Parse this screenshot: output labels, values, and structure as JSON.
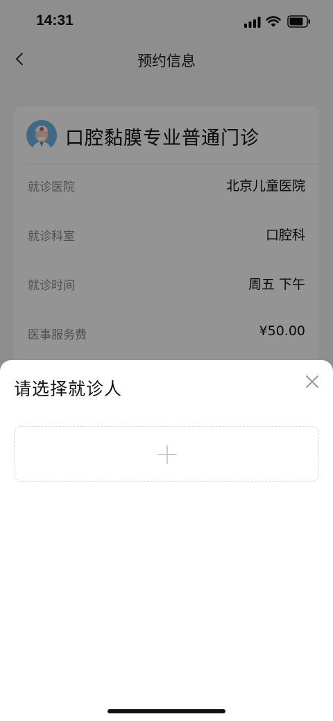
{
  "status_bar": {
    "time": "14:31"
  },
  "nav": {
    "title": "预约信息"
  },
  "card": {
    "title": "口腔黏膜专业普通门诊",
    "rows": [
      {
        "label": "就诊医院",
        "value": "北京儿童医院"
      },
      {
        "label": "就诊科室",
        "value": "口腔科"
      },
      {
        "label": "就诊时间",
        "value": "周五 下午"
      },
      {
        "label": "医事服务费",
        "value": "¥50.00"
      }
    ]
  },
  "sheet": {
    "title": "请选择就诊人"
  }
}
